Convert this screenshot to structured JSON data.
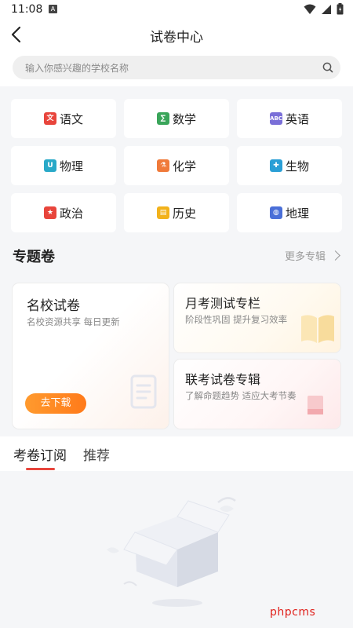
{
  "status_bar": {
    "time": "11:08",
    "sim_label": "A"
  },
  "header": {
    "title": "试卷中心"
  },
  "search": {
    "placeholder": "输入你感兴趣的学校名称"
  },
  "subjects": [
    {
      "label": "语文",
      "icon": "chinese-icon",
      "color": "#e8453c"
    },
    {
      "label": "数学",
      "icon": "math-icon",
      "color": "#3aa55a"
    },
    {
      "label": "英语",
      "icon": "english-icon",
      "color": "#7a6fd8"
    },
    {
      "label": "物理",
      "icon": "physics-icon",
      "color": "#29a9c8"
    },
    {
      "label": "化学",
      "icon": "chemistry-icon",
      "color": "#f07a3a"
    },
    {
      "label": "生物",
      "icon": "biology-icon",
      "color": "#2a9fd6"
    },
    {
      "label": "政治",
      "icon": "politics-icon",
      "color": "#e8453c"
    },
    {
      "label": "历史",
      "icon": "history-icon",
      "color": "#f2b21b"
    },
    {
      "label": "地理",
      "icon": "geography-icon",
      "color": "#4a6fd8"
    }
  ],
  "special": {
    "title": "专题卷",
    "more_label": "更多专辑",
    "cards": {
      "famous": {
        "title": "名校试卷",
        "subtitle": "名校资源共享 每日更新",
        "button": "去下载"
      },
      "monthly": {
        "title": "月考测试专栏",
        "subtitle": "阶段性巩固 提升复习效率"
      },
      "joint": {
        "title": "联考试卷专辑",
        "subtitle": "了解命题趋势 适应大考节奏"
      }
    }
  },
  "tabs": [
    {
      "label": "考卷订阅",
      "active": true
    },
    {
      "label": "推荐",
      "active": false
    }
  ],
  "watermark": "phpcms",
  "colors": {
    "accent": "#e8453c",
    "button_orange": "#ff8a23"
  }
}
